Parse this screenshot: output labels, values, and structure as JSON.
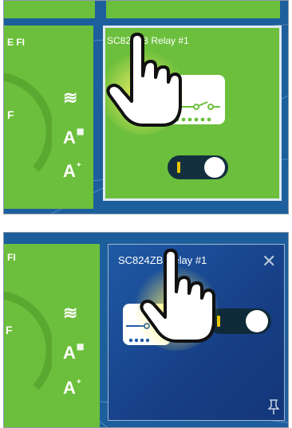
{
  "panels": [
    {
      "state": "before",
      "left_card": {
        "title_partial": "E FI",
        "gauge_letter": "F"
      },
      "side_icons": [
        {
          "name": "heat-waves-icon",
          "glyph": "≋"
        },
        {
          "name": "auto-schedule-icon",
          "glyph": "A",
          "sup": "▦"
        },
        {
          "name": "auto-plus-icon",
          "glyph": "A",
          "sup": "+"
        }
      ],
      "relay_card": {
        "title": "SC824ZB Relay #1",
        "state": "selected",
        "toggle_on": true
      }
    },
    {
      "state": "after",
      "left_card": {
        "title_partial": "FI",
        "gauge_letter": "F"
      },
      "side_icons": [
        {
          "name": "heat-waves-icon",
          "glyph": "≋"
        },
        {
          "name": "auto-schedule-icon",
          "glyph": "A",
          "sup": "▦"
        },
        {
          "name": "auto-plus-icon",
          "glyph": "A",
          "sup": "+"
        }
      ],
      "relay_card": {
        "title": "SC824ZB Relay #1",
        "state": "expanded",
        "toggle_on": true,
        "close_glyph": "✕"
      }
    }
  ],
  "colors": {
    "panel_bg": "#1d5f9c",
    "card_green": "#6cbf3c",
    "card_blue": "#173f86",
    "toggle_track": "#14303f",
    "toggle_mark": "#e9c500",
    "hand_glow": "#fff36a"
  }
}
